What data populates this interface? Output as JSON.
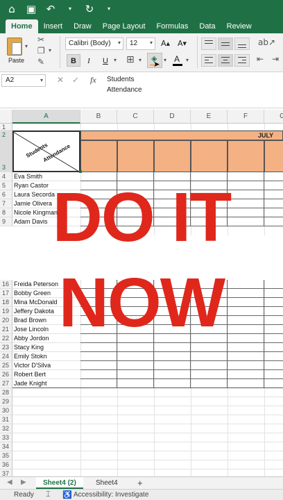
{
  "titlebar": {
    "icons": [
      "home-icon",
      "save-icon",
      "undo-icon",
      "redo-icon",
      "dropdown-icon"
    ]
  },
  "tabs": [
    {
      "label": "Home",
      "active": true
    },
    {
      "label": "Insert",
      "active": false
    },
    {
      "label": "Draw",
      "active": false
    },
    {
      "label": "Page Layout",
      "active": false
    },
    {
      "label": "Formulas",
      "active": false
    },
    {
      "label": "Data",
      "active": false
    },
    {
      "label": "Review",
      "active": false
    }
  ],
  "ribbon": {
    "paste_label": "Paste",
    "font_name": "Calibri (Body)",
    "font_size": "12",
    "bold": "B",
    "italic": "I",
    "underline": "U",
    "increase_font": "A▴",
    "decrease_font": "A▾",
    "font_color_letter": "A"
  },
  "formula_bar": {
    "name_box": "A2",
    "fx": "fx",
    "content_line1": "Students",
    "content_line2": "Attendance"
  },
  "sheet": {
    "columns": [
      "A",
      "B",
      "C",
      "D",
      "E",
      "F",
      "G"
    ],
    "month_label": "JULY",
    "header_cell": {
      "top_text": "Students",
      "bottom_text": "Attendance"
    },
    "students_top": [
      {
        "row": "4",
        "name": "Eva Smith"
      },
      {
        "row": "5",
        "name": "Ryan Castor"
      },
      {
        "row": "6",
        "name": "Laura Secorda"
      },
      {
        "row": "7",
        "name": "Jamie Olivera"
      },
      {
        "row": "8",
        "name": "Nicole Kingman"
      },
      {
        "row": "9",
        "name": "Adam Davis"
      }
    ],
    "students_bottom": [
      {
        "row": "16",
        "name": "Freida Peterson"
      },
      {
        "row": "17",
        "name": "Bobby Green"
      },
      {
        "row": "18",
        "name": "Mina McDonald"
      },
      {
        "row": "19",
        "name": "Jeffery Dakota"
      },
      {
        "row": "20",
        "name": "Brad Brown"
      },
      {
        "row": "21",
        "name": "Jose Lincoln"
      },
      {
        "row": "22",
        "name": "Abby Jordon"
      },
      {
        "row": "23",
        "name": "Stacy King"
      },
      {
        "row": "24",
        "name": "Emily Stokn"
      },
      {
        "row": "25",
        "name": "Victor D'Silva"
      },
      {
        "row": "26",
        "name": "Robert Bert"
      },
      {
        "row": "27",
        "name": "Jade Knight"
      }
    ],
    "empty_rows": [
      "28",
      "29",
      "30",
      "31",
      "32",
      "33",
      "34",
      "35",
      "36",
      "37"
    ]
  },
  "overlay": {
    "line1": "DO IT",
    "line2": "NOW",
    "color": "#e0271c"
  },
  "sheet_tabs": [
    {
      "label": "Sheet4 (2)",
      "active": true
    },
    {
      "label": "Sheet4",
      "active": false
    }
  ],
  "add_sheet": "+",
  "status": {
    "ready": "Ready",
    "accessibility": "Accessibility: Investigate"
  },
  "colors": {
    "excel_green": "#1f7145",
    "header_fill": "#f4b183"
  }
}
